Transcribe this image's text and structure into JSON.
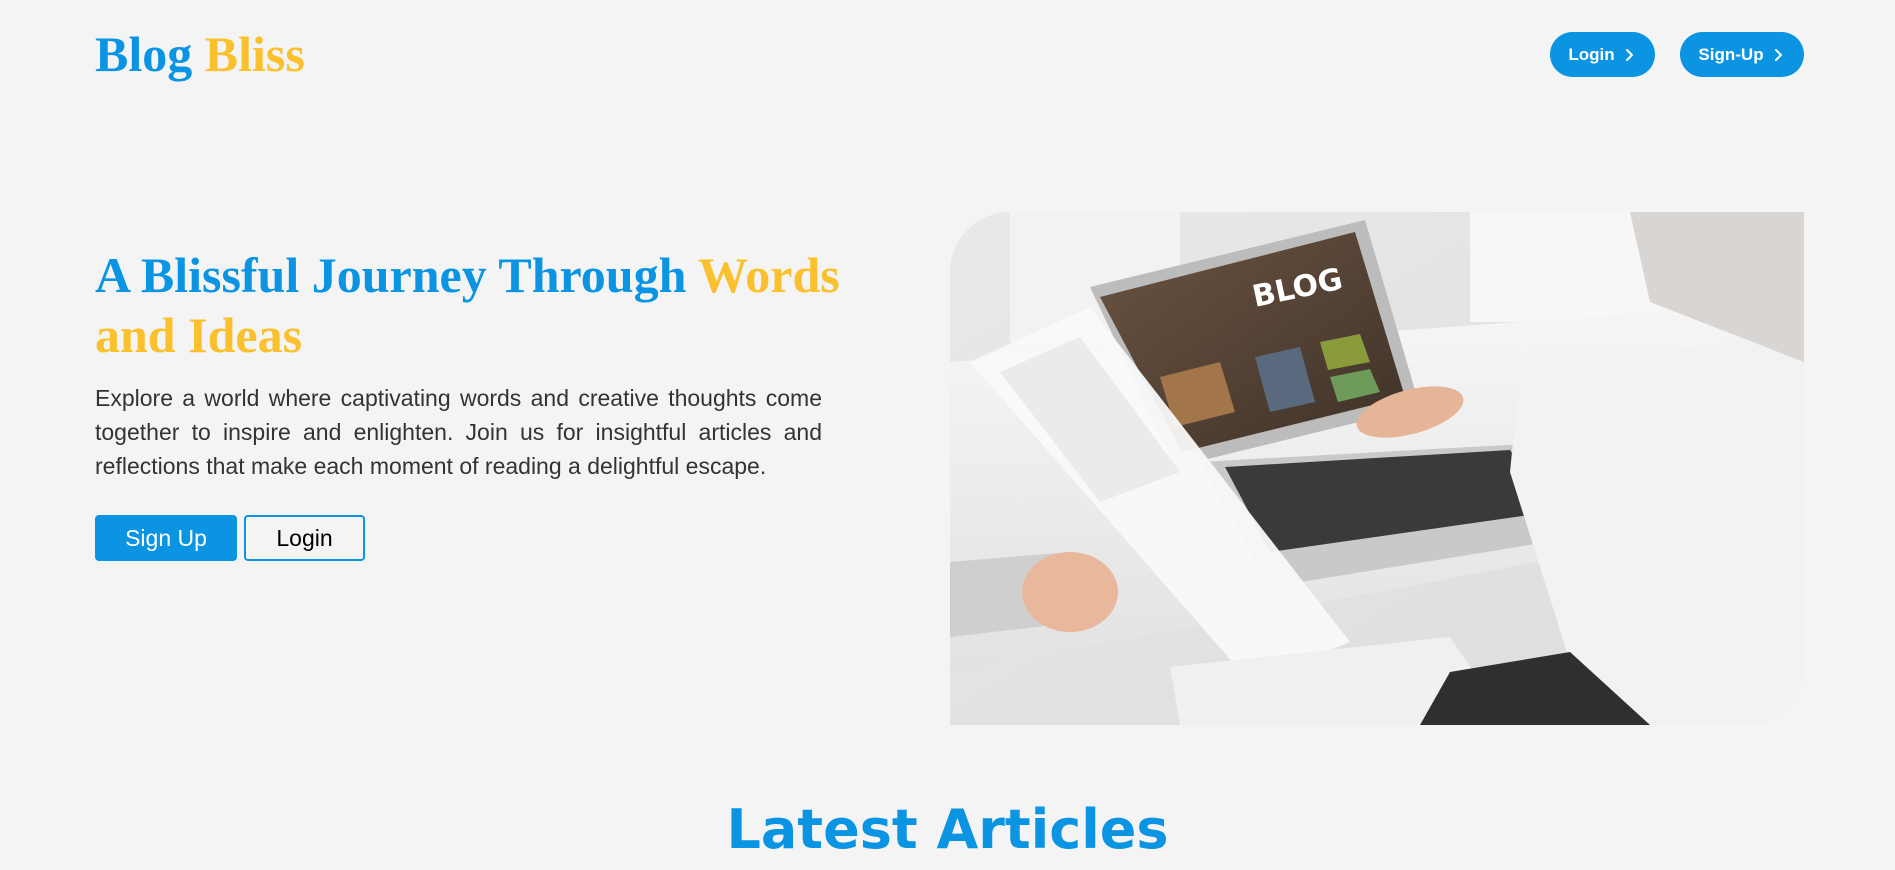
{
  "header": {
    "logo_part1": "Blog",
    "logo_part2": "Bliss",
    "login_label": "Login",
    "signup_label": "Sign-Up"
  },
  "hero": {
    "title_blue": "A Blissful Journey Through ",
    "title_gold": "Words and Ideas",
    "description": "Explore a world where captivating words and creative thoughts come together to inspire and enlighten. Join us for insightful articles and reflections that make each moment of reading a delightful escape.",
    "signup_label": "Sign Up",
    "login_label": "Login",
    "image_screen_text": "BLOG"
  },
  "latest": {
    "title": "Latest Articles"
  },
  "colors": {
    "brand_blue": "#0b94e2",
    "brand_gold": "#fbc02d",
    "background": "#f4f4f4"
  },
  "icons": {
    "header_button_icon": "chevron-right-icon"
  }
}
